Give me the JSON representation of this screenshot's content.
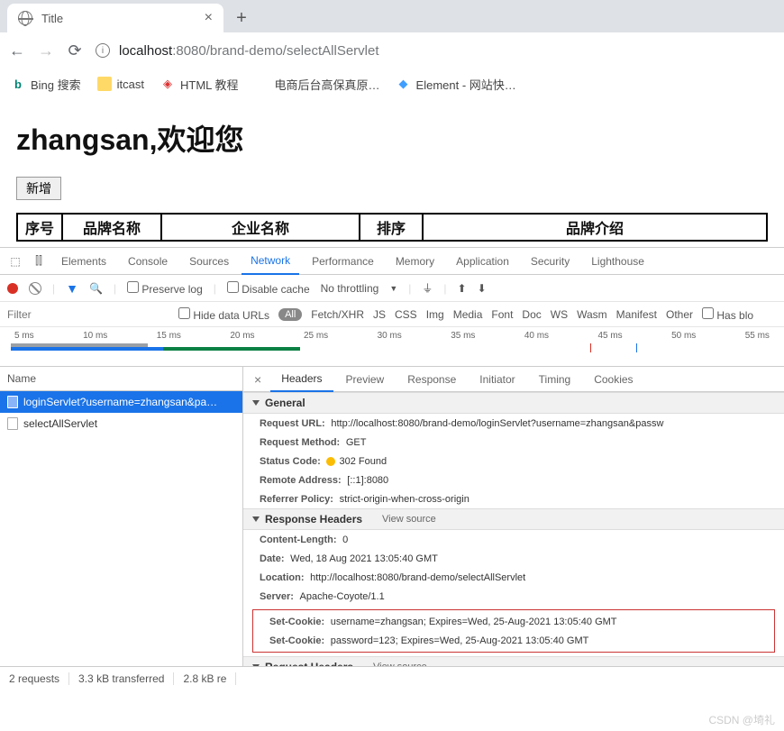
{
  "tab": {
    "title": "Title"
  },
  "address": {
    "host": "localhost",
    "port": ":8080",
    "path": "/brand-demo/selectAllServlet"
  },
  "bookmarks": [
    {
      "label": "Bing 搜索"
    },
    {
      "label": "itcast"
    },
    {
      "label": "HTML 教程"
    },
    {
      "label": "电商后台高保真原…"
    },
    {
      "label": "Element - 网站快…"
    }
  ],
  "page": {
    "welcome": "zhangsan,欢迎您",
    "add_btn": "新增",
    "columns": [
      "序号",
      "品牌名称",
      "企业名称",
      "排序",
      "品牌介绍"
    ]
  },
  "devtools": {
    "tabs": [
      "Elements",
      "Console",
      "Sources",
      "Network",
      "Performance",
      "Memory",
      "Application",
      "Security",
      "Lighthouse"
    ],
    "active_tab": "Network",
    "row2": {
      "preserve": "Preserve log",
      "disable": "Disable cache",
      "throttle": "No throttling"
    },
    "row3": {
      "filter_ph": "Filter",
      "hide": "Hide data URLs",
      "all": "All",
      "types": [
        "Fetch/XHR",
        "JS",
        "CSS",
        "Img",
        "Media",
        "Font",
        "Doc",
        "WS",
        "Wasm",
        "Manifest",
        "Other"
      ],
      "hasblo": "Has blo"
    },
    "timeline": [
      "5 ms",
      "10 ms",
      "15 ms",
      "20 ms",
      "25 ms",
      "30 ms",
      "35 ms",
      "40 ms",
      "45 ms",
      "50 ms",
      "55 ms"
    ],
    "name_header": "Name",
    "requests": [
      {
        "name": "loginServlet?username=zhangsan&pa…",
        "selected": true
      },
      {
        "name": "selectAllServlet",
        "selected": false
      }
    ],
    "detail_tabs": [
      "Headers",
      "Preview",
      "Response",
      "Initiator",
      "Timing",
      "Cookies"
    ],
    "general_label": "General",
    "general": {
      "url_k": "Request URL:",
      "url_v": "http://localhost:8080/brand-demo/loginServlet?username=zhangsan&passw",
      "method_k": "Request Method:",
      "method_v": "GET",
      "status_k": "Status Code:",
      "status_v": "302 Found",
      "remote_k": "Remote Address:",
      "remote_v": "[::1]:8080",
      "ref_k": "Referrer Policy:",
      "ref_v": "strict-origin-when-cross-origin"
    },
    "resp_label": "Response Headers",
    "view_source": "View source",
    "resp": {
      "cl_k": "Content-Length:",
      "cl_v": "0",
      "date_k": "Date:",
      "date_v": "Wed, 18 Aug 2021 13:05:40 GMT",
      "loc_k": "Location:",
      "loc_v": "http://localhost:8080/brand-demo/selectAllServlet",
      "srv_k": "Server:",
      "srv_v": "Apache-Coyote/1.1",
      "c1_k": "Set-Cookie:",
      "c1_v": "username=zhangsan; Expires=Wed, 25-Aug-2021 13:05:40 GMT",
      "c2_k": "Set-Cookie:",
      "c2_v": "password=123; Expires=Wed, 25-Aug-2021 13:05:40 GMT"
    },
    "req_label": "Request Headers",
    "status_bar": [
      "2 requests",
      "3.3 kB transferred",
      "2.8 kB re"
    ]
  },
  "watermark": "CSDN @埼礼"
}
